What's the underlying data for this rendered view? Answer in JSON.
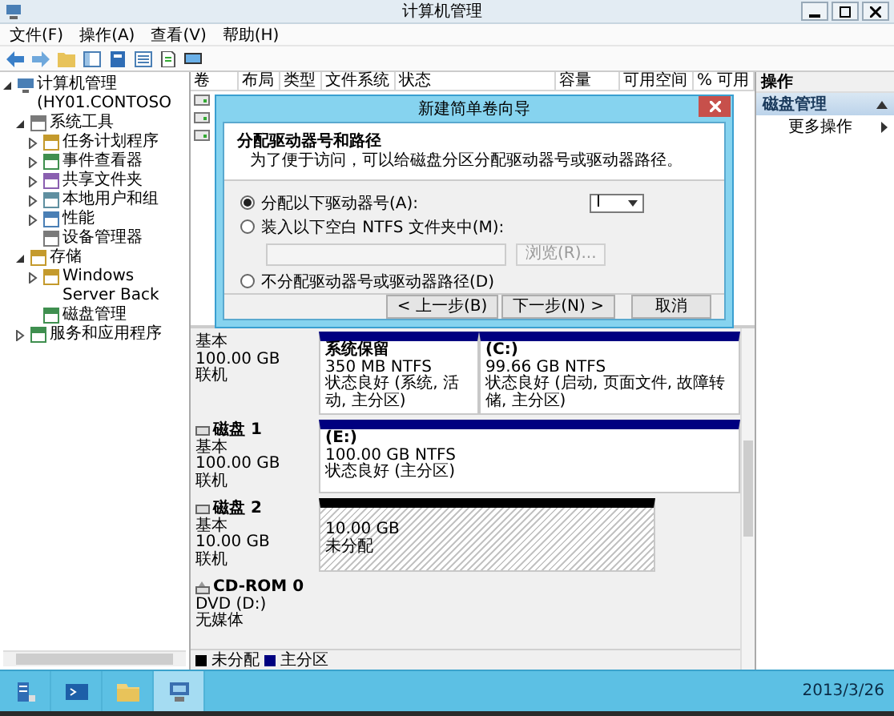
{
  "window": {
    "title": "计算机管理"
  },
  "menu": [
    "文件(F)",
    "操作(A)",
    "查看(V)",
    "帮助(H)"
  ],
  "tree": [
    {
      "label": "计算机管理 (HY01.CONTOSO",
      "expanded": true,
      "children": [
        {
          "label": "系统工具",
          "expanded": true,
          "children": [
            {
              "label": "任务计划程序",
              "expanded": false
            },
            {
              "label": "事件查看器",
              "expanded": false
            },
            {
              "label": "共享文件夹",
              "expanded": false
            },
            {
              "label": "本地用户和组",
              "expanded": false
            },
            {
              "label": "性能",
              "expanded": false
            },
            {
              "label": "设备管理器"
            }
          ]
        },
        {
          "label": "存储",
          "expanded": true,
          "children": [
            {
              "label": "Windows Server Back",
              "expanded": false
            },
            {
              "label": "磁盘管理"
            }
          ]
        },
        {
          "label": "服务和应用程序",
          "expanded": false
        }
      ]
    }
  ],
  "volume_list": {
    "columns": [
      "卷",
      "布局",
      "类型",
      "文件系统",
      "状态",
      "容量",
      "可用空间",
      "% 可用"
    ],
    "rows": [
      {
        "kind": "volume"
      },
      {
        "kind": "volume"
      },
      {
        "kind": "volume"
      }
    ]
  },
  "disks": [
    {
      "kind": "disk",
      "type": "基本",
      "size": "100.00 GB",
      "status": "联机",
      "partitions": [
        {
          "kind": "primary",
          "name": "系统保留",
          "size": "350 MB NTFS",
          "status": "状态良好 (系统, 活动, 主分区)"
        },
        {
          "kind": "primary",
          "name": "(C:)",
          "size": "99.66 GB NTFS",
          "status": "状态良好 (启动, 页面文件, 故障转储, 主分区)"
        }
      ]
    },
    {
      "kind": "disk",
      "name": "磁盘 1",
      "type": "基本",
      "size": "100.00 GB",
      "status": "联机",
      "partitions": [
        {
          "kind": "primary",
          "name": "(E:)",
          "size": "100.00 GB NTFS",
          "status": "状态良好 (主分区)"
        }
      ]
    },
    {
      "kind": "disk",
      "name": "磁盘 2",
      "type": "基本",
      "size": "10.00 GB",
      "status": "联机",
      "partitions": [
        {
          "kind": "unallocated",
          "size": "10.00 GB",
          "status": "未分配"
        }
      ]
    },
    {
      "kind": "cdrom",
      "name": "CD-ROM 0",
      "type": "DVD (D:)",
      "status": "无媒体"
    }
  ],
  "legend": [
    {
      "label": "未分配",
      "color": "#000000"
    },
    {
      "label": "主分区",
      "color": "#000080"
    }
  ],
  "actions": {
    "title": "操作",
    "section": "磁盘管理",
    "items": [
      "更多操作"
    ]
  },
  "dialog": {
    "title": "新建简单卷向导",
    "heading": "分配驱动器号和路径",
    "description": "为了便于访问，可以给磁盘分区分配驱动器号或驱动器路径。",
    "options": [
      {
        "kind": "letter",
        "label": "分配以下驱动器号(A):",
        "selected": true
      },
      {
        "kind": "folder",
        "label": "装入以下空白 NTFS 文件夹中(M):",
        "selected": false
      },
      {
        "kind": "none",
        "label": "不分配驱动器号或驱动器路径(D)",
        "selected": false
      }
    ],
    "drive_letter": "I",
    "folder_field": {
      "disabled": true
    },
    "browse_button": {
      "label": "浏览(R)...",
      "disabled": true
    },
    "buttons": [
      "< 上一步(B)",
      "下一步(N) >",
      "取消"
    ]
  },
  "taskbar": {
    "apps": [
      {
        "kind": "server",
        "selected": false
      },
      {
        "kind": "terminal",
        "selected": false
      },
      {
        "kind": "folder",
        "selected": false
      },
      {
        "kind": "management",
        "selected": true
      }
    ],
    "clock": "2013/3/26"
  }
}
